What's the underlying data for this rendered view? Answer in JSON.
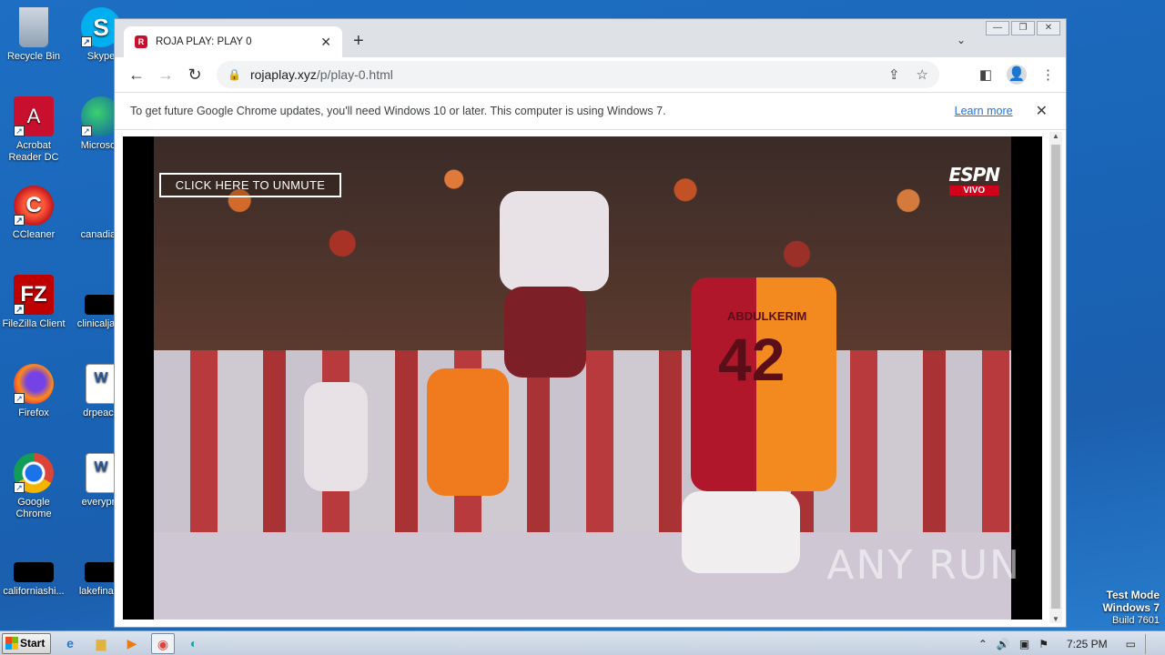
{
  "desktop": {
    "icons": [
      {
        "label": "Recycle Bin"
      },
      {
        "label": "Skype"
      },
      {
        "label": "Acrobat Reader DC"
      },
      {
        "label": "Microsoft"
      },
      {
        "label": "CCleaner"
      },
      {
        "label": "canadian"
      },
      {
        "label": "FileZilla Client"
      },
      {
        "label": "clinicaljack"
      },
      {
        "label": "Firefox"
      },
      {
        "label": "drpeace"
      },
      {
        "label": "Google Chrome"
      },
      {
        "label": "everypre"
      },
      {
        "label": "californiashi..."
      },
      {
        "label": "lakefinally"
      }
    ]
  },
  "browser": {
    "tab": {
      "title": "ROJA PLAY: PLAY 0",
      "favicon": "R"
    },
    "address": {
      "host": "rojaplay.xyz",
      "path": "/p/play-0.html"
    },
    "infobar": {
      "message": "To get future Google Chrome updates, you'll need Windows 10 or later. This computer is using Windows 7.",
      "link": "Learn more"
    },
    "video": {
      "unmute_label": "CLICK HERE TO UNMUTE",
      "network": "ESPN",
      "live_badge": "VIVO",
      "jersey_name": "ABDULKERIM",
      "jersey_number": "42"
    },
    "watermark": "ANY RUN"
  },
  "taskbar": {
    "start_label": "Start",
    "clock": "7:25 PM"
  },
  "os_overlay": {
    "line1": "Test Mode",
    "line2": "Windows 7",
    "line3": "Build 7601"
  },
  "colors": {
    "desktop_bg": "#1d6fc4",
    "accent_link": "#1a73e8",
    "espn_red": "#d0021b"
  }
}
